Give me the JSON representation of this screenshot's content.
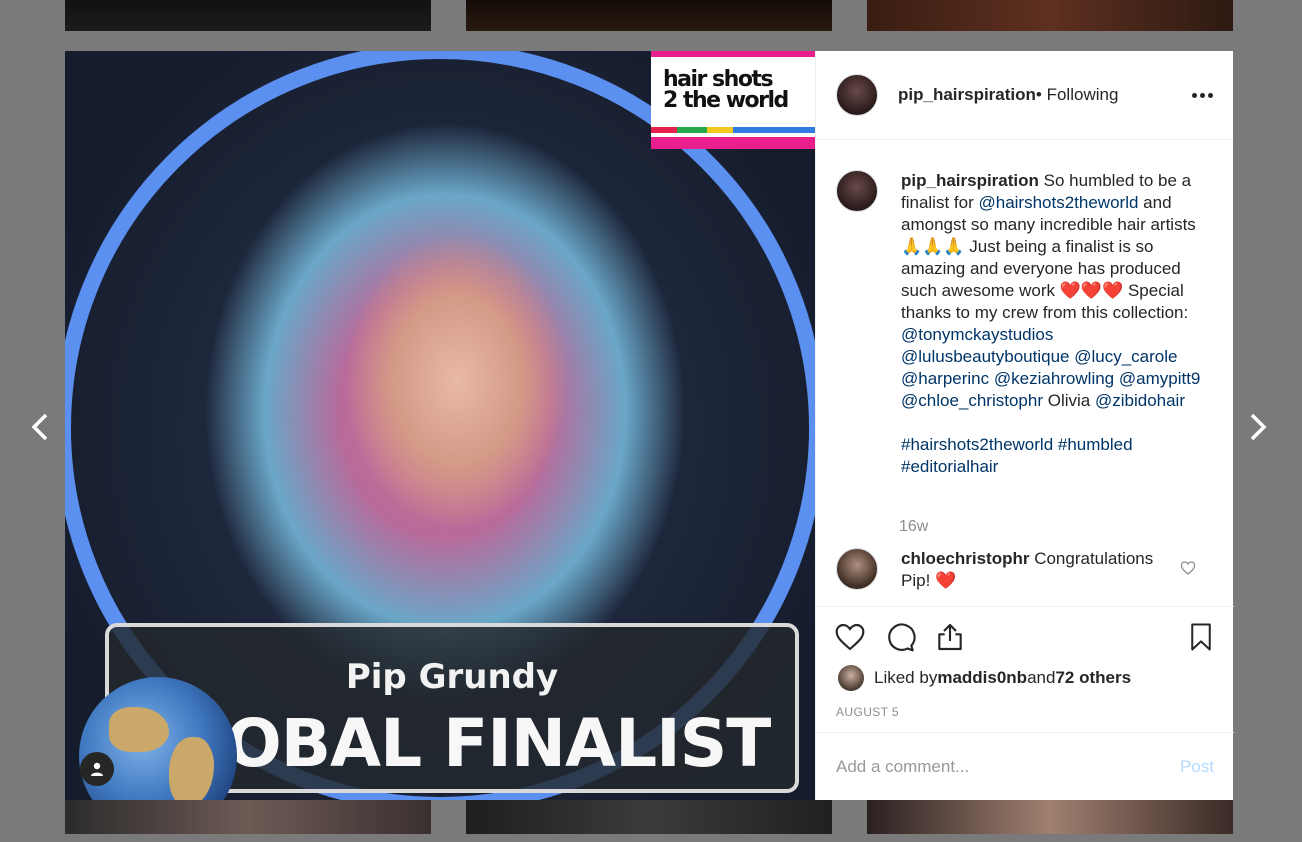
{
  "post": {
    "banner_name": "Pip Grundy",
    "banner_title": "GLOBAL FINALIST",
    "brand_line1": "hair shots",
    "brand_line2": "2 the world"
  },
  "header": {
    "username": "pip_hairspiration",
    "following": " • Following"
  },
  "caption": {
    "username": "pip_hairspiration",
    "t1": " So humbled to be a finalist for ",
    "m1": "@hairshots2theworld",
    "t2": " and amongst so many incredible hair artists ",
    "e1": "🙏🙏🙏",
    "t3": " Just being a finalist is so amazing and everyone has produced such awesome work ",
    "e2": "❤️❤️❤️",
    "t4": " Special thanks to my crew from this collection: ",
    "m2": "@tonymckaystudios",
    "m3": "@lulusbeautyboutique",
    "m4": "@lucy_carole",
    "m5": "@harperinc",
    "m6": "@keziahrowling",
    "m7": "@amypitt9",
    "m8": "@chloe_christophr",
    "t5": " Olivia ",
    "m9": "@zibidohair",
    "h1": "#hairshots2theworld",
    "h2": "#humbled",
    "h3": "#editorialhair"
  },
  "time": "16w",
  "comment": {
    "username": "chloechristophr",
    "text": " Congratulations Pip! ",
    "emoji": "❤️"
  },
  "likes": {
    "prefix": "Liked by ",
    "user": "maddis0nb",
    "middle": " and ",
    "others": "72 others"
  },
  "date": "AUGUST 5",
  "add_comment": {
    "placeholder": "Add a comment...",
    "post_label": "Post"
  },
  "colors": {
    "link": "#003569",
    "ring": "#5b8ff0",
    "post_disabled": "#b3dbff"
  }
}
